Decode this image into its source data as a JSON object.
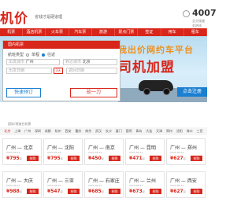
{
  "header": {
    "logo": "机价",
    "tagline": "省钱才是硬道理",
    "phone": "4007",
    "phone_sub": "全天候服务热线"
  },
  "nav": {
    "items": [
      "机票",
      "酒店机票",
      "火车票",
      "汽车票",
      "旅游",
      "景点门票",
      "签证",
      "用车",
      "租车"
    ]
  },
  "hero": {
    "line1": "我出价网约车平台",
    "line2": "司机加盟",
    "cta": "点击注册"
  },
  "search": {
    "title": "国内机票",
    "trip_label": "航班类型",
    "trip_options": [
      "单程",
      "往返"
    ],
    "from_label": "出发城市",
    "from_value": "广州",
    "to_label": "到达城市",
    "to_value": "北京",
    "date_label": "出发日期",
    "date_value": "",
    "return_date": "3天",
    "return_label": "返回日期",
    "return_value": "",
    "primary_button": "快速预订",
    "secondary_button": "砍一刀"
  },
  "section": {
    "title": "国际/港澳台机票"
  },
  "cities": [
    "北京",
    "上海",
    "广州",
    "深圳",
    "成都",
    "杭州",
    "西安",
    "重庆",
    "南京",
    "武汉",
    "长沙",
    "厦门",
    "昆明",
    "青岛",
    "大连",
    "天津",
    "郑州",
    "沈阳",
    "海口",
    "三亚"
  ],
  "flights": [
    {
      "route": "广州 — 北京",
      "date": "2023-06-21",
      "price": "795",
      "unit": "起",
      "book": "抢购"
    },
    {
      "route": "广州 — 沈阳",
      "date": "2023-06-21",
      "price": "795",
      "unit": "起",
      "book": "抢购"
    },
    {
      "route": "广州 — 南京",
      "date": "2023-06-21",
      "price": "450",
      "unit": "起",
      "book": "抢购"
    },
    {
      "route": "广州 — 昆明",
      "date": "2023-06-21",
      "price": "471",
      "unit": "起",
      "book": "抢购"
    },
    {
      "route": "广州 — 郑州",
      "date": "2023-06-21",
      "price": "627",
      "unit": "起",
      "book": "抢购"
    },
    {
      "route": "广州 — 大庆",
      "date": "2023-06-21",
      "price": "988",
      "unit": "起",
      "book": "抢购"
    },
    {
      "route": "广州 — 三亚",
      "date": "2023-06-21",
      "price": "547",
      "unit": "起",
      "book": "抢购"
    },
    {
      "route": "广州 — 石家庄",
      "date": "2023-06-21",
      "price": "685",
      "unit": "起",
      "book": "抢购"
    },
    {
      "route": "广州 — 兰州",
      "date": "2023-06-21",
      "price": "673",
      "unit": "起",
      "book": "抢购"
    },
    {
      "route": "广州 — 西安",
      "date": "2023-06-21",
      "price": "627",
      "unit": "起",
      "book": "抢购"
    }
  ]
}
